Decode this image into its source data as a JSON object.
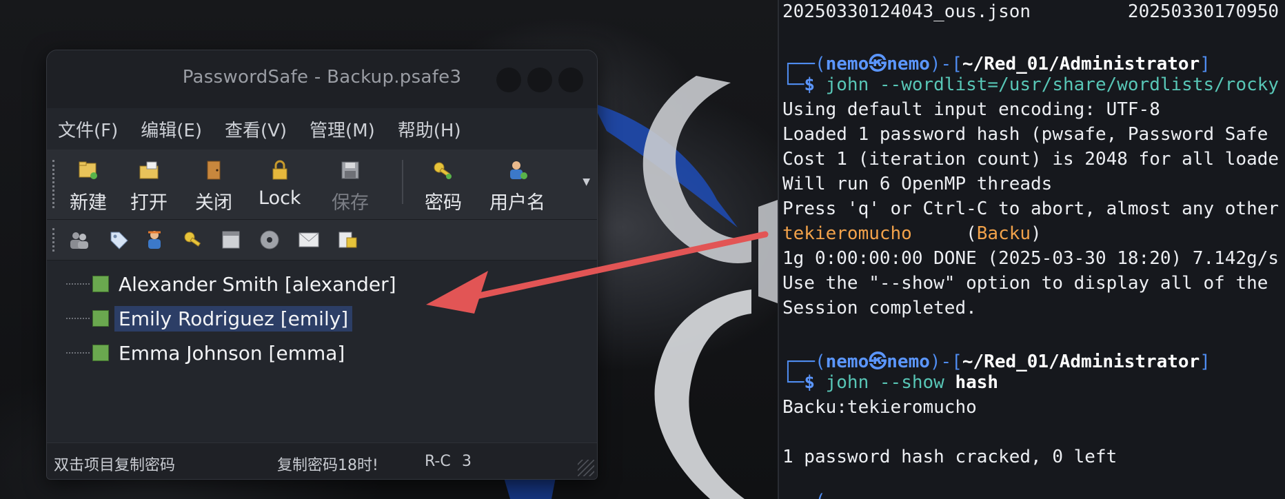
{
  "window": {
    "title": "PasswordSafe - Backup.psafe3"
  },
  "menu": [
    "文件(F)",
    "编辑(E)",
    "查看(V)",
    "管理(M)",
    "帮助(H)"
  ],
  "toolbar": {
    "new_label": "新建",
    "open_label": "打开",
    "close_label": "关闭",
    "lock_label": "Lock",
    "save_label": "保存",
    "password_label": "密码",
    "username_label": "用户名"
  },
  "toolbar2_icons": [
    "user-group-icon",
    "tag-icon",
    "person-icon",
    "key-icon",
    "window-icon",
    "disc-icon",
    "mail-icon",
    "export-icon"
  ],
  "entries": [
    {
      "label": "Alexander Smith [alexander]",
      "selected": false
    },
    {
      "label": "Emily Rodriguez [emily]",
      "selected": true
    },
    {
      "label": "Emma Johnson [emma]",
      "selected": false
    }
  ],
  "status": {
    "hint": "双击项目复制密码",
    "copy": "复制密码18时!",
    "mode": "R-C",
    "count": "3"
  },
  "terminal": {
    "line0_a": "20250330124043_ous.json",
    "line0_b": "20250330170950",
    "prompt1": {
      "user": "nemo",
      "host": "nemo",
      "path": "~/Red_01/Administrator",
      "cmd": "john --wordlist=/usr/share/wordlists/rocky"
    },
    "out1": [
      "Using default input encoding: UTF-8",
      "Loaded 1 password hash (pwsafe, Password Safe",
      "Cost 1 (iteration count) is 2048 for all loade",
      "Will run 6 OpenMP threads",
      "Press 'q' or Ctrl-C to abort, almost any other"
    ],
    "cracked_pw": "tekieromucho",
    "cracked_name": "Backu",
    "out2": [
      "1g 0:00:00:00 DONE (2025-03-30 18:20) 7.142g/s",
      "Use the \"--show\" option to display all of the",
      "Session completed."
    ],
    "prompt2": {
      "user": "nemo",
      "host": "nemo",
      "path": "~/Red_01/Administrator",
      "cmd": "john --show",
      "arg": "hash"
    },
    "out3": "Backu:tekieromucho",
    "out4": "1 password hash cracked, 0 left"
  },
  "colors": {
    "accent_arrow": "#e25555",
    "prompt_blue": "#4f8cf0",
    "cmd_teal": "#58c6b6",
    "highlight_orange": "#f2a24a",
    "selection": "#2c3e66",
    "leaf_green": "#6aa84f"
  }
}
